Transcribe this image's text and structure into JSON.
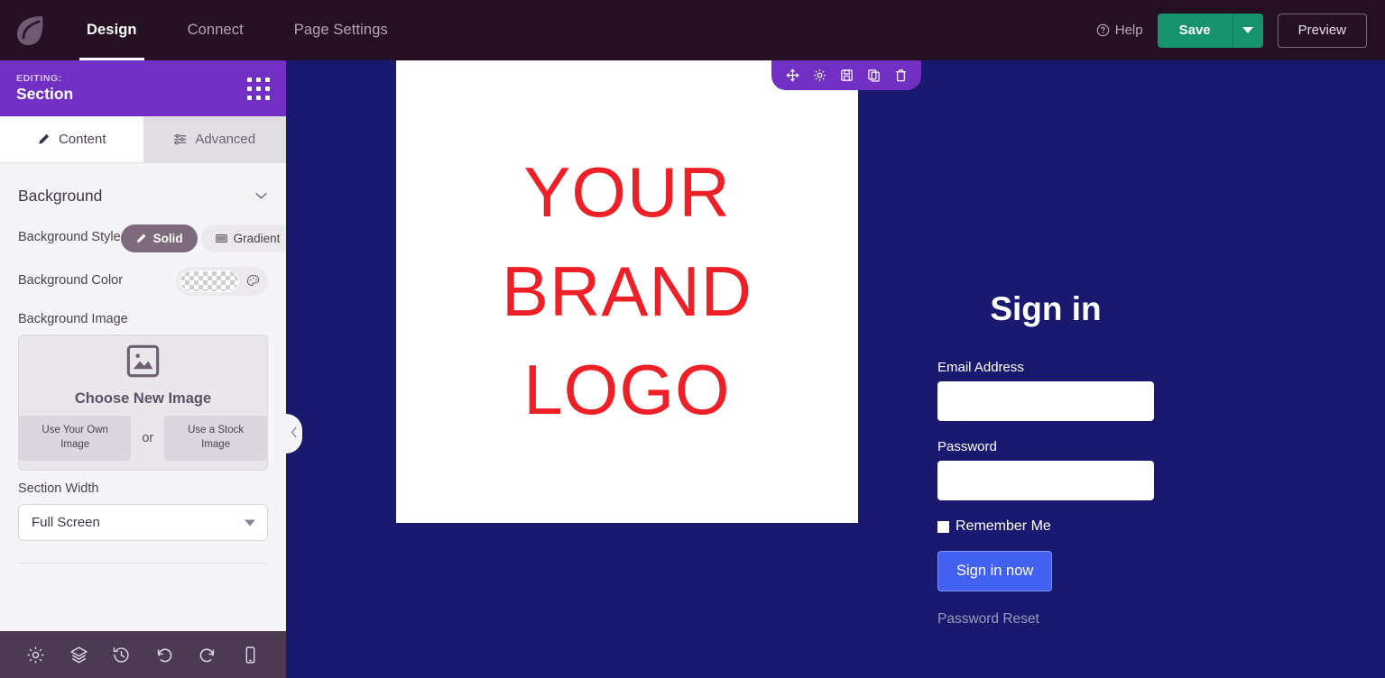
{
  "topbar": {
    "logo_icon": "leaf-logo-icon",
    "nav": [
      {
        "label": "Design",
        "active": true
      },
      {
        "label": "Connect",
        "active": false
      },
      {
        "label": "Page Settings",
        "active": false
      }
    ],
    "help_label": "Help",
    "help_icon": "question-circle-icon",
    "save_label": "Save",
    "save_caret_icon": "chevron-down-icon",
    "preview_label": "Preview",
    "colors": {
      "bar_bg": "#250f22",
      "save_green": "#15936a",
      "active_text": "#ffffff",
      "inactive_text": "#b4a4b8"
    }
  },
  "sidebar": {
    "editing_label": "EDITING:",
    "editing_title": "Section",
    "grid_icon": "grid-dots-icon",
    "header_color": "#7130c3",
    "tabs": [
      {
        "label": "Content",
        "icon": "pencil-icon",
        "active": true
      },
      {
        "label": "Advanced",
        "icon": "sliders-icon",
        "active": false
      }
    ],
    "background_section": {
      "title": "Background",
      "collapse_icon": "chevron-down-icon",
      "background_style": {
        "label": "Background Style",
        "options": [
          {
            "label": "Solid",
            "icon": "pencil-icon",
            "selected": true
          },
          {
            "label": "Gradient",
            "icon": "gradient-swatch-icon",
            "selected": false
          }
        ]
      },
      "background_color": {
        "label": "Background Color",
        "value": "transparent",
        "palette_icon": "palette-icon"
      },
      "background_image": {
        "label": "Background Image",
        "placeholder_icon": "image-placeholder-icon",
        "title": "Choose New Image",
        "own_image_label": "Use Your Own Image",
        "or_label": "or",
        "stock_image_label": "Use a Stock Image"
      },
      "section_width": {
        "label": "Section Width",
        "value": "Full Screen",
        "caret_icon": "chevron-down-icon"
      }
    },
    "collapse_handle_icon": "chevron-left-icon",
    "bottom_toolbar": [
      {
        "icon": "gear-icon",
        "name": "global-settings"
      },
      {
        "icon": "layers-icon",
        "name": "layers"
      },
      {
        "icon": "history-icon",
        "name": "revision-history"
      },
      {
        "icon": "undo-icon",
        "name": "undo"
      },
      {
        "icon": "redo-icon",
        "name": "redo"
      },
      {
        "icon": "mobile-icon",
        "name": "responsive-preview"
      }
    ]
  },
  "canvas": {
    "background_color": "#191970",
    "section_toolbar": [
      {
        "icon": "move-icon",
        "name": "move-section"
      },
      {
        "icon": "gear-icon",
        "name": "section-settings"
      },
      {
        "icon": "save-icon",
        "name": "save-section"
      },
      {
        "icon": "duplicate-icon",
        "name": "duplicate-section"
      },
      {
        "icon": "trash-icon",
        "name": "delete-section"
      }
    ],
    "logo_panel": {
      "lines": [
        "YOUR",
        "BRAND",
        "LOGO"
      ],
      "text_color": "#ed2027",
      "panel_color": "#ffffff"
    },
    "signin_form": {
      "title": "Sign in",
      "email_label": "Email Address",
      "email_value": "",
      "password_label": "Password",
      "password_value": "",
      "remember_label": "Remember Me",
      "remember_checked": false,
      "submit_label": "Sign in now",
      "submit_color": "#4361f0",
      "reset_link_label": "Password Reset"
    }
  }
}
